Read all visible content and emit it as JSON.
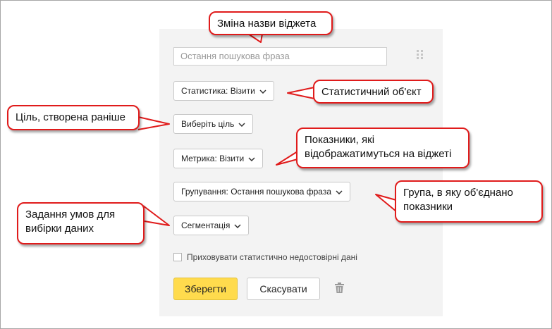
{
  "widget": {
    "name_input": {
      "placeholder": "Остання пошукова фраза"
    },
    "statistics_dropdown": "Статистика: Візити",
    "goal_dropdown": "Виберіть ціль",
    "metric_dropdown": "Метрика: Візити",
    "grouping_dropdown": "Групування: Остання пошукова фраза",
    "segmentation_dropdown": "Сегментація",
    "hide_checkbox": {
      "label": "Приховувати статистично недостовірні дані",
      "checked": false
    },
    "save_button": "Зберегти",
    "cancel_button": "Скасувати",
    "icons": {
      "drag": "drag-handle-icon",
      "delete": "trash-icon",
      "dropdown": "chevron-down-icon"
    }
  },
  "callouts": {
    "rename": "Зміна назви віджета",
    "statistic_object": "Статистичний об'єкт",
    "goal": "Ціль, створена раніше",
    "metrics": "Показники, які відображатимуться на віджеті",
    "group": "Група, в яку об'єднано показники",
    "conditions": "Задання умов для вибірки даних"
  },
  "colors": {
    "callout_border": "#e01b1b",
    "save_button": "#ffdb4d",
    "panel": "#f3f3f3"
  }
}
